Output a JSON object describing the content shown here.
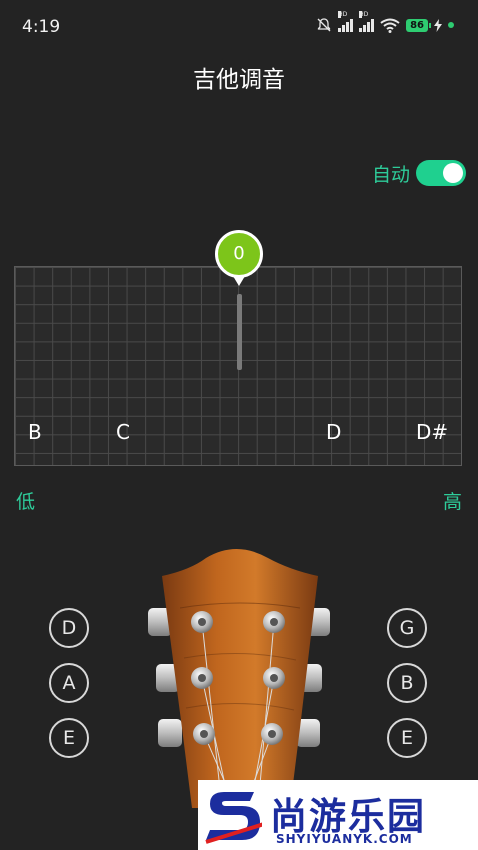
{
  "status_bar": {
    "time": "4:19",
    "battery": "86",
    "icons": [
      "mute-icon",
      "signal-hd-icon",
      "signal-hd-icon",
      "wifi-icon",
      "battery-icon",
      "charging-icon",
      "notification-dot-icon"
    ]
  },
  "header": {
    "title": "吉他调音"
  },
  "auto_mode": {
    "label": "自动",
    "enabled": true
  },
  "tuner": {
    "offset_value": "0",
    "notes": [
      "B",
      "C",
      "D",
      "D#"
    ],
    "low_label": "低",
    "high_label": "高"
  },
  "strings": {
    "left": [
      "D",
      "A",
      "E"
    ],
    "right": [
      "G",
      "B",
      "E"
    ]
  },
  "promo": {
    "name": "尚游乐园",
    "url": "SHYIYUANYK.COM"
  },
  "colors": {
    "accent": "#2ecc9a",
    "bubble": "#7dc51a",
    "background": "#232323",
    "brand": "#1c2d9e"
  }
}
